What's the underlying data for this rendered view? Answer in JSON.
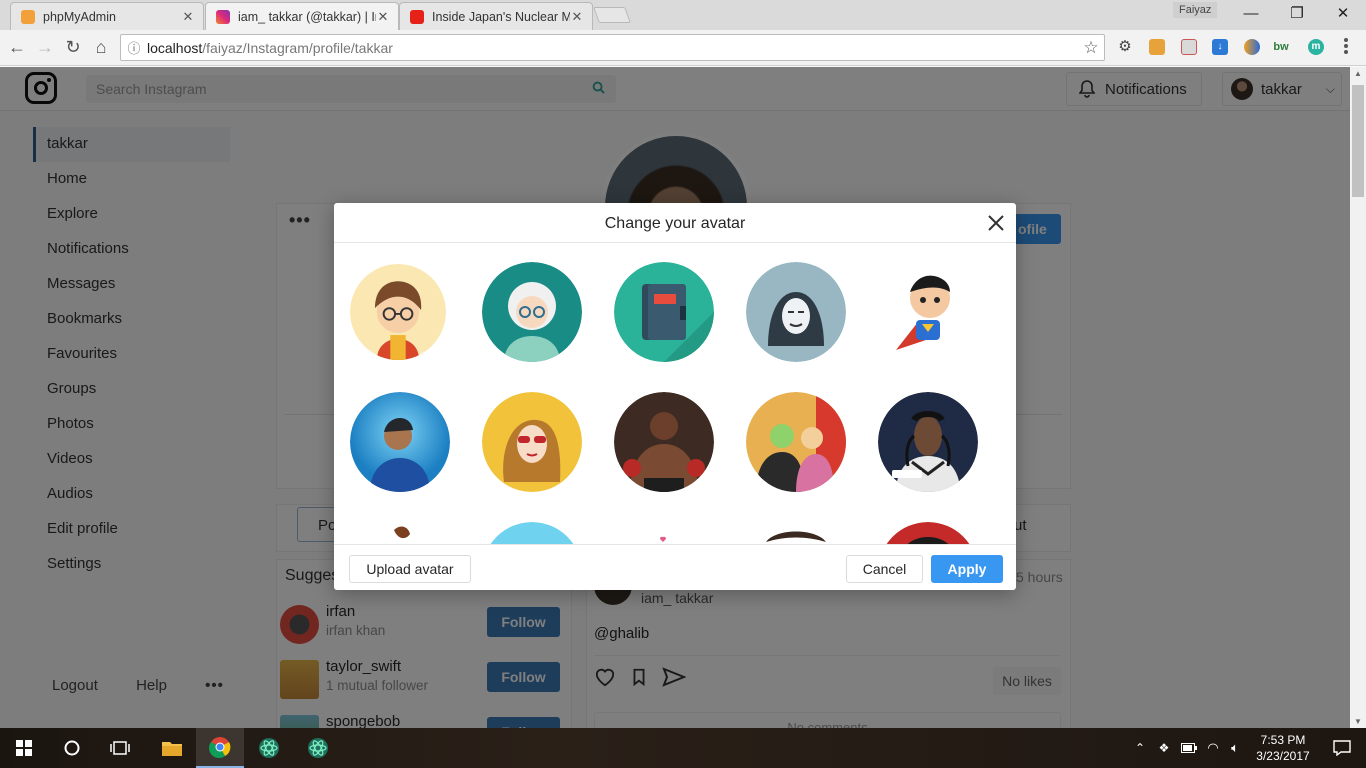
{
  "browser": {
    "tabs": [
      {
        "title": "phpMyAdmin",
        "active": false
      },
      {
        "title": "iam_ takkar (@takkar) | In",
        "active": true
      },
      {
        "title": "Inside Japan's Nuclear M",
        "active": false
      }
    ],
    "profile_name": "Faiyaz",
    "url_host": "localhost",
    "url_path": "/faiyaz/Instagram/profile/takkar"
  },
  "topnav": {
    "search_placeholder": "Search Instagram",
    "notifications_label": "Notifications",
    "username": "takkar"
  },
  "sidebar": {
    "items": [
      "takkar",
      "Home",
      "Explore",
      "Notifications",
      "Messages",
      "Bookmarks",
      "Favourites",
      "Groups",
      "Photos",
      "Videos",
      "Audios",
      "Edit profile",
      "Settings"
    ],
    "footer": {
      "logout": "Logout",
      "help": "Help",
      "more": "•••"
    }
  },
  "profile": {
    "edit_button_partial": "ofile",
    "more": "•••",
    "posts_tab_partial": "Po",
    "about_tab_partial": "ut"
  },
  "suggestions": {
    "title_partial": "Sugges",
    "items": [
      {
        "name": "irfan",
        "sub": "irfan khan",
        "action": "Follow"
      },
      {
        "name": "taylor_swift",
        "sub": "1 mutual follower",
        "action": "Follow"
      },
      {
        "name": "spongebob",
        "sub": "",
        "action": "Follow"
      }
    ]
  },
  "post": {
    "username": "iam_ takkar",
    "time_partial": "5 hours",
    "text": "@ghalib",
    "likes": "No likes",
    "comments": "No comments"
  },
  "modal": {
    "title": "Change your avatar",
    "upload_label": "Upload avatar",
    "cancel_label": "Cancel",
    "apply_label": "Apply"
  },
  "colors": {
    "accent": "#3897f0",
    "follow": "#3a7bb7",
    "overlay": "rgba(0,0,0,0.5)"
  },
  "taskbar": {
    "time": "7:53 PM",
    "date": "3/23/2017"
  }
}
